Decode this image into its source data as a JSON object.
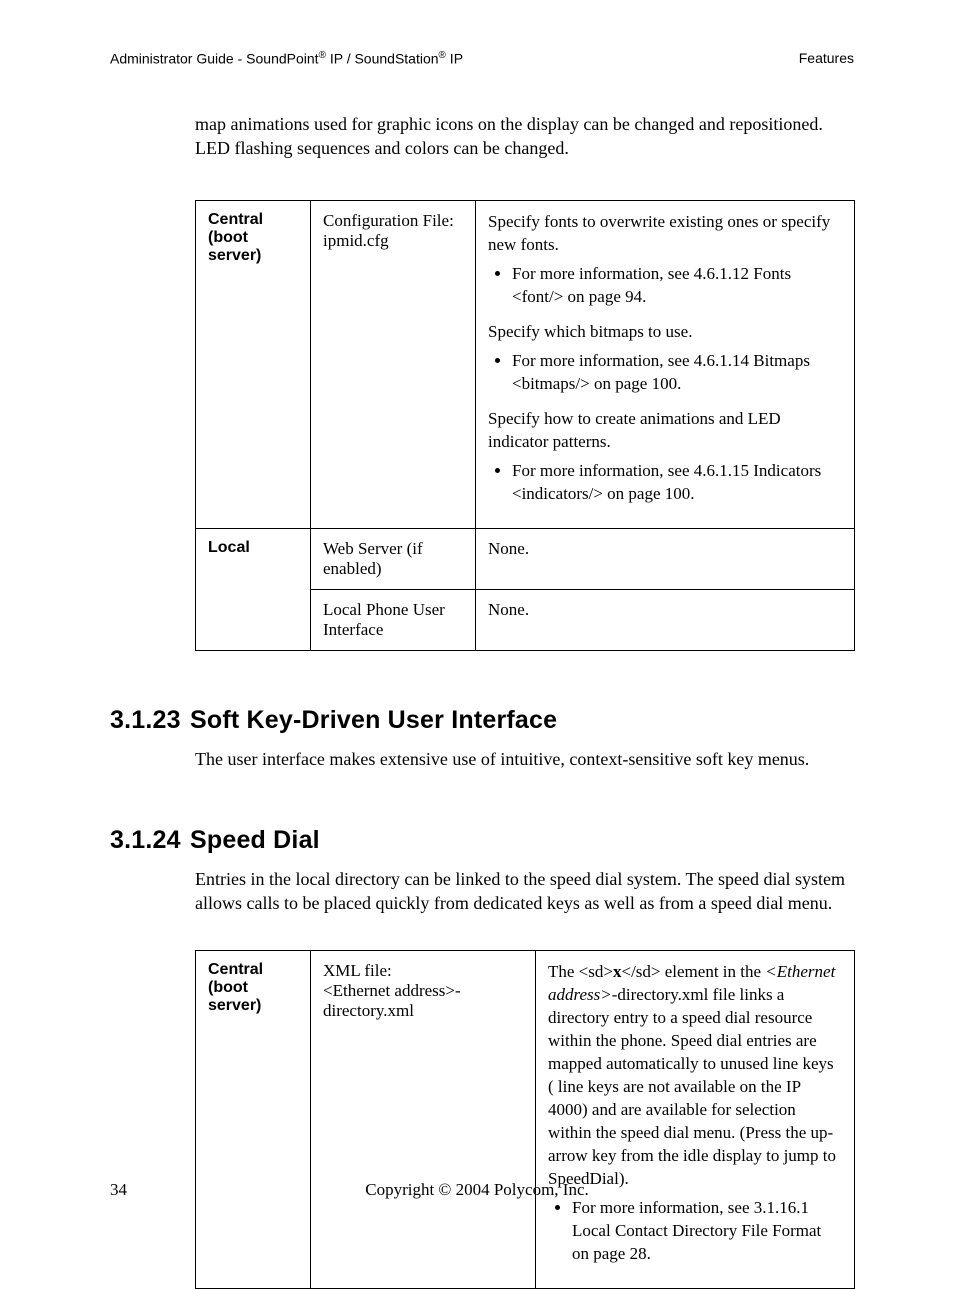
{
  "header": {
    "left_prefix": "Administrator Guide - SoundPoint",
    "left_mid": " IP / SoundStation",
    "left_suffix": " IP",
    "reg": "®",
    "right": "Features"
  },
  "intro": "map animations used for graphic icons on the display can be changed and repositioned.  LED flashing sequences and colors can be changed.",
  "table1": {
    "row1_head": "Central (boot server)",
    "row1_col2_a": "Configuration File:",
    "row1_col2_b": "ipmid.cfg",
    "row1_p1": "Specify fonts to overwrite existing ones or specify new fonts.",
    "row1_b1": "For more information, see 4.6.1.12 Fonts <font/> on page 94.",
    "row1_p2": "Specify which bitmaps to use.",
    "row1_b2": "For more information, see 4.6.1.14 Bitmaps <bitmaps/> on page 100.",
    "row1_p3": "Specify how to create animations and LED indicator patterns.",
    "row1_b3": "For more information, see 4.6.1.15 Indicators <indicators/> on page 100.",
    "row2_head": "Local",
    "row2a_col2": "Web Server (if enabled)",
    "row2a_col3": "None.",
    "row2b_col2": "Local Phone User Interface",
    "row2b_col3": "None."
  },
  "section1": {
    "num": "3.1.23",
    "title": "Soft Key-Driven User Interface",
    "body": "The user interface makes extensive use of intuitive, context-sensitive soft key menus."
  },
  "section2": {
    "num": "3.1.24",
    "title": "Speed Dial",
    "body": "Entries in the local directory can be linked to the speed dial system.  The speed dial system allows calls to be placed quickly from dedicated keys as well as from a speed dial menu."
  },
  "table2": {
    "row1_head": "Central (boot server)",
    "row1_col2_a": "XML file:",
    "row1_col2_b": "<Ethernet address>-directory.xml",
    "row1_col3_pre": "The <sd>",
    "row1_col3_bold": "x",
    "row1_col3_mid": "</sd> element in the ",
    "row1_col3_ital": "<Ethernet address>",
    "row1_col3_post": "-directory.xml file links a directory entry to a speed dial resource within the phone.  Speed dial entries are mapped automatically to unused line keys ( line keys are not available on the IP 4000) and are available for selection within the speed dial menu. (Press the up-arrow key from the idle display to jump to SpeedDial).",
    "row1_b1": "For more information, see 3.1.16.1 Local Contact Directory File Format on page 28."
  },
  "footer": {
    "page": "34",
    "copy": "Copyright © 2004 Polycom, Inc."
  }
}
